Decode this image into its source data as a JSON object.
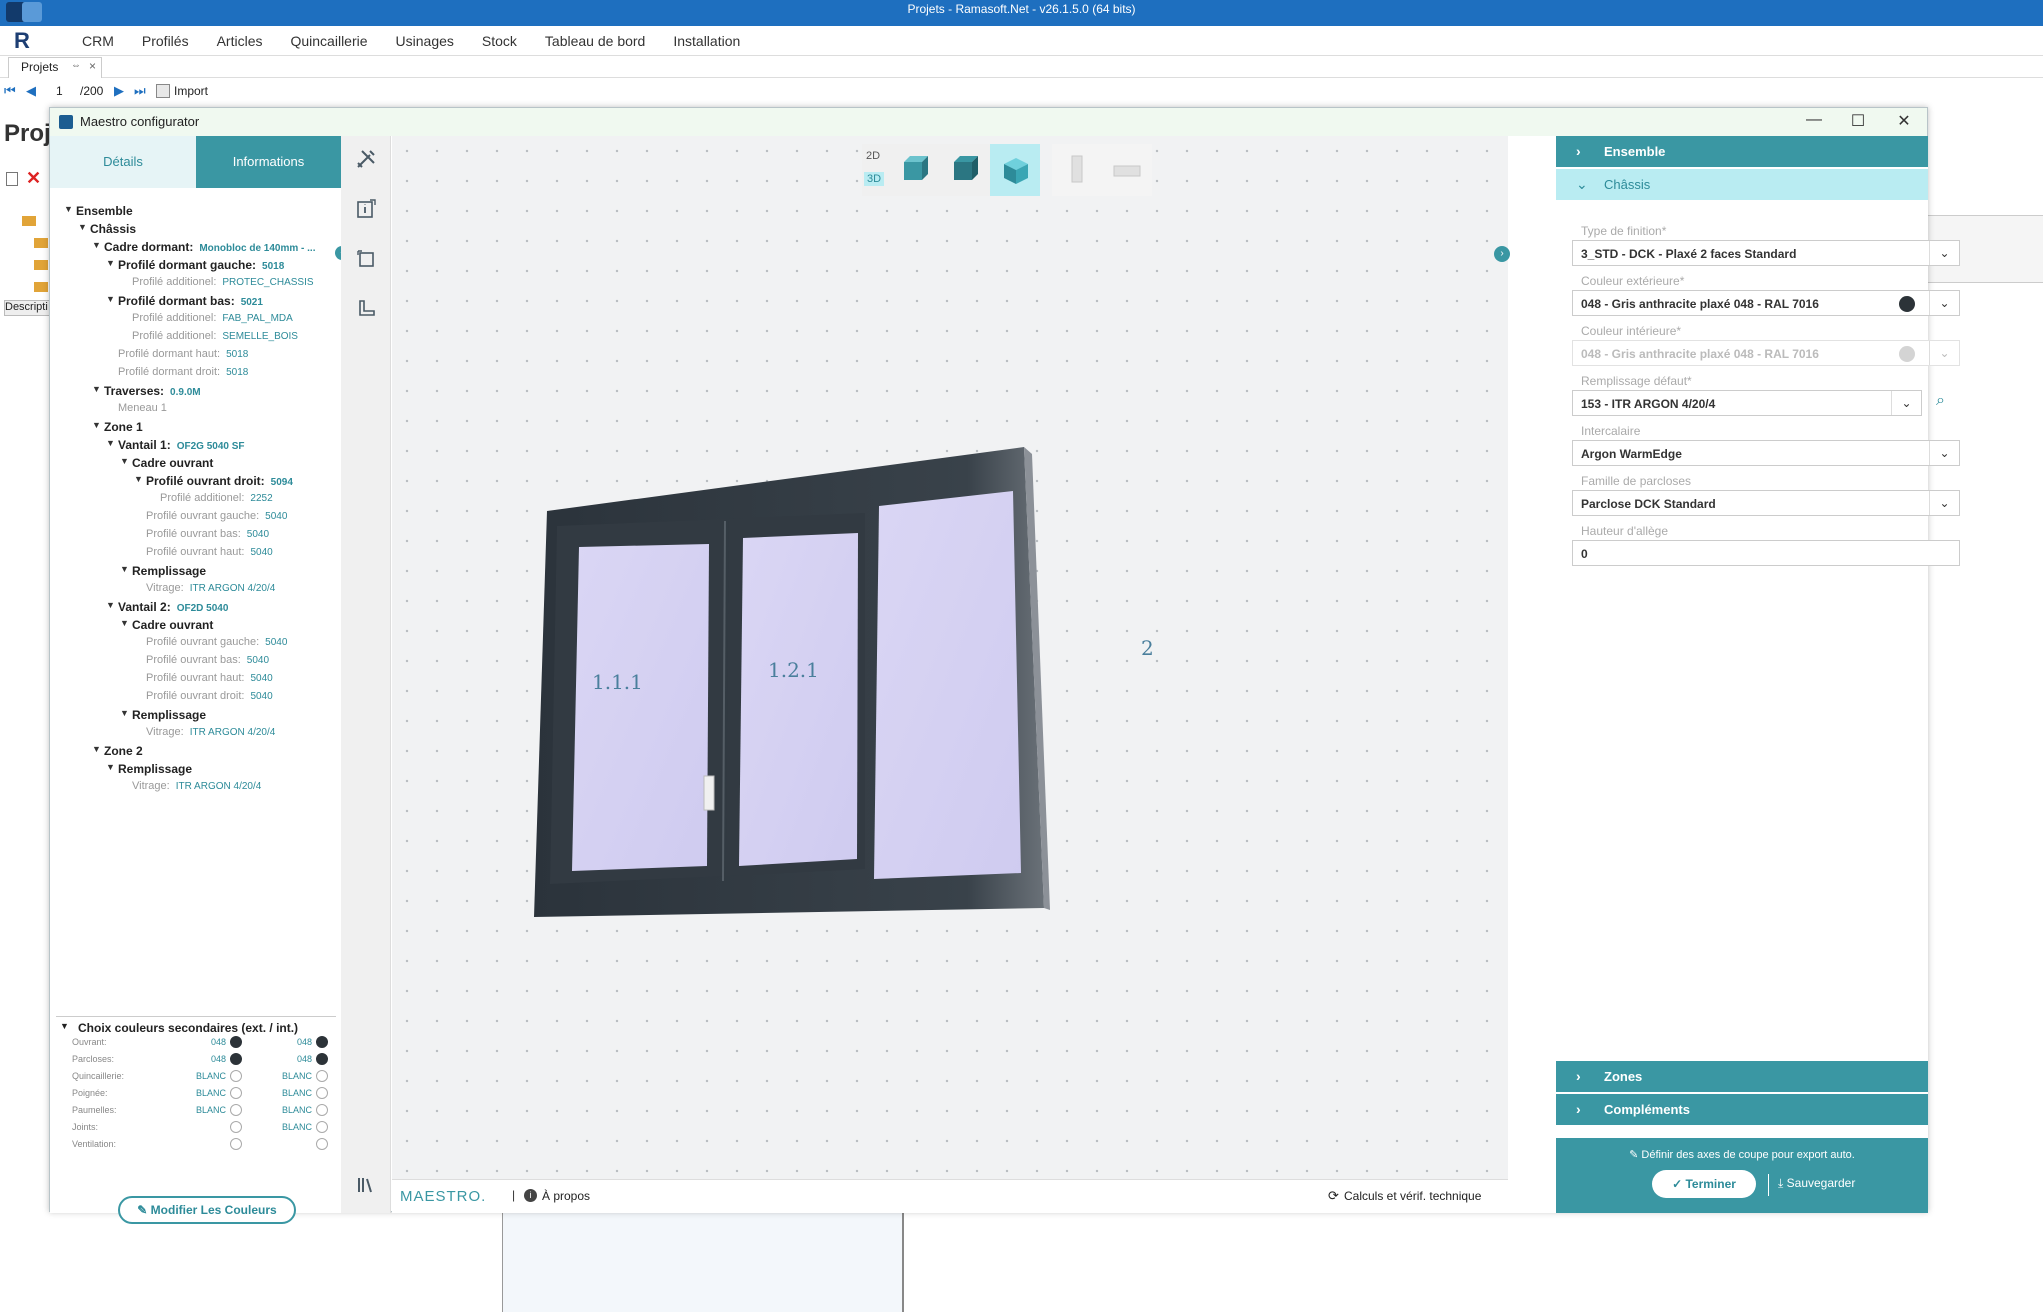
{
  "app": {
    "title": "Projets - Ramasoft.Net - v26.1.5.0 (64 bits)",
    "logo": "R",
    "menu": [
      "CRM",
      "Profilés",
      "Articles",
      "Quincaillerie",
      "Usinages",
      "Stock",
      "Tableau de bord",
      "Installation"
    ],
    "tab": {
      "label": "Projets",
      "pin": "⇔",
      "close": "×"
    },
    "nav": {
      "page": "1",
      "total": "/200",
      "import_label": "Import"
    },
    "bg": {
      "title_partial": "Proj",
      "desc": "Descripti"
    }
  },
  "window": {
    "title": "Maestro configurator",
    "controls": {
      "minimize": "—",
      "maximize": "☐",
      "close": "✕"
    }
  },
  "left": {
    "tabs": {
      "details": "Détails",
      "info": "Informations"
    },
    "tree": [
      {
        "label": "Ensemble",
        "level": 0,
        "kind": "hd",
        "caret": true
      },
      {
        "label": "Châssis",
        "level": 1,
        "kind": "hd",
        "caret": true
      },
      {
        "label": "Cadre dormant:",
        "value": "Monobloc de 140mm - ...",
        "level": 2,
        "kind": "hd",
        "caret": true
      },
      {
        "label": "Profilé dormant gauche:",
        "value": "5018",
        "level": 3,
        "kind": "hd",
        "caret": true
      },
      {
        "label": "Profilé additionel:",
        "value": "PROTEC_CHASSIS",
        "level": 4,
        "kind": "mu"
      },
      {
        "label": "Profilé dormant bas:",
        "value": "5021",
        "level": 3,
        "kind": "hd",
        "caret": true
      },
      {
        "label": "Profilé additionel:",
        "value": "FAB_PAL_MDA",
        "level": 4,
        "kind": "mu"
      },
      {
        "label": "Profilé additionel:",
        "value": "SEMELLE_BOIS",
        "level": 4,
        "kind": "mu"
      },
      {
        "label": "Profilé dormant haut:",
        "value": "5018",
        "level": 3,
        "kind": "mu"
      },
      {
        "label": "Profilé dormant droit:",
        "value": "5018",
        "level": 3,
        "kind": "mu"
      },
      {
        "label": "Traverses:",
        "value": "0.9.0M",
        "level": 2,
        "kind": "hd",
        "caret": true
      },
      {
        "label": "Meneau 1",
        "level": 3,
        "kind": "mu"
      },
      {
        "label": "Zone 1",
        "level": 2,
        "kind": "hd",
        "caret": true
      },
      {
        "label": "Vantail 1:",
        "value": "OF2G 5040 SF",
        "level": 3,
        "kind": "hd",
        "caret": true
      },
      {
        "label": "Cadre ouvrant",
        "level": 4,
        "kind": "hd",
        "caret": true
      },
      {
        "label": "Profilé ouvrant droit:",
        "value": "5094",
        "level": 5,
        "kind": "hd",
        "caret": true
      },
      {
        "label": "Profilé additionel:",
        "value": "2252",
        "level": 6,
        "kind": "mu"
      },
      {
        "label": "Profilé ouvrant gauche:",
        "value": "5040",
        "level": 5,
        "kind": "mu"
      },
      {
        "label": "Profilé ouvrant bas:",
        "value": "5040",
        "level": 5,
        "kind": "mu"
      },
      {
        "label": "Profilé ouvrant haut:",
        "value": "5040",
        "level": 5,
        "kind": "mu"
      },
      {
        "label": "Remplissage",
        "level": 4,
        "kind": "hd",
        "caret": true
      },
      {
        "label": "Vitrage:",
        "value": "ITR ARGON 4/20/4",
        "level": 5,
        "kind": "mu"
      },
      {
        "label": "Vantail 2:",
        "value": "OF2D 5040",
        "level": 3,
        "kind": "hd",
        "caret": true
      },
      {
        "label": "Cadre ouvrant",
        "level": 4,
        "kind": "hd",
        "caret": true
      },
      {
        "label": "Profilé ouvrant gauche:",
        "value": "5040",
        "level": 5,
        "kind": "mu"
      },
      {
        "label": "Profilé ouvrant bas:",
        "value": "5040",
        "level": 5,
        "kind": "mu"
      },
      {
        "label": "Profilé ouvrant haut:",
        "value": "5040",
        "level": 5,
        "kind": "mu"
      },
      {
        "label": "Profilé ouvrant droit:",
        "value": "5040",
        "level": 5,
        "kind": "mu"
      },
      {
        "label": "Remplissage",
        "level": 4,
        "kind": "hd",
        "caret": true
      },
      {
        "label": "Vitrage:",
        "value": "ITR ARGON 4/20/4",
        "level": 5,
        "kind": "mu"
      },
      {
        "label": "Zone 2",
        "level": 2,
        "kind": "hd",
        "caret": true
      },
      {
        "label": "Remplissage",
        "level": 3,
        "kind": "hd",
        "caret": true
      },
      {
        "label": "Vitrage:",
        "value": "ITR ARGON 4/20/4",
        "level": 4,
        "kind": "mu"
      }
    ],
    "colors": {
      "title": "Choix couleurs secondaires (ext. / int.)",
      "rows": [
        {
          "label": "Ouvrant:",
          "ext": "048",
          "int": "048",
          "ext_dark": true,
          "int_dark": true
        },
        {
          "label": "Parcloses:",
          "ext": "048",
          "int": "048",
          "ext_dark": true,
          "int_dark": true
        },
        {
          "label": "Quincaillerie:",
          "ext": "BLANC",
          "int": "BLANC",
          "ext_dark": false,
          "int_dark": false
        },
        {
          "label": "Poignée:",
          "ext": "BLANC",
          "int": "BLANC",
          "ext_dark": false,
          "int_dark": false
        },
        {
          "label": "Paumelles:",
          "ext": "BLANC",
          "int": "BLANC",
          "ext_dark": false,
          "int_dark": false
        },
        {
          "label": "Joints:",
          "ext": "",
          "int": "BLANC",
          "ext_dark": false,
          "int_dark": false
        },
        {
          "label": "Ventilation:",
          "ext": "",
          "int": "",
          "ext_dark": false,
          "int_dark": false
        }
      ],
      "button": "Modifier Les Couleurs"
    }
  },
  "toolbar": {
    "icons": [
      "tools-icon",
      "info-panel-icon",
      "frame-select-icon",
      "profile-section-icon",
      "library-icon"
    ]
  },
  "viewport": {
    "view": {
      "2d": "2D",
      "3d": "3D"
    },
    "zones": [
      "1.1.1",
      "1.2.1",
      "2"
    ],
    "footer": {
      "brand": "MAESTRO.",
      "about": "À propos",
      "calc": "Calculs et vérif. technique"
    }
  },
  "right": {
    "sections": {
      "ensemble": "Ensemble",
      "chassis": "Châssis",
      "zones": "Zones",
      "complements": "Compléments"
    },
    "fields": [
      {
        "label": "Type de finition*",
        "value": "3_STD - DCK - Plaxé 2 faces Standard",
        "disabled": false,
        "color": ""
      },
      {
        "label": "Couleur extérieure*",
        "value": "048 - Gris anthracite plaxé 048 - RAL 7016",
        "disabled": false,
        "color": "#2c3338"
      },
      {
        "label": "Couleur intérieure*",
        "value": "048 - Gris anthracite plaxé 048 - RAL 7016",
        "disabled": true,
        "color": "#d4d4d4"
      },
      {
        "label": "Remplissage défaut*",
        "value": "153 - ITR ARGON 4/20/4",
        "disabled": false,
        "color": "",
        "search": true
      },
      {
        "label": "Intercalaire",
        "value": "Argon WarmEdge",
        "disabled": false,
        "color": ""
      },
      {
        "label": "Famille de parcloses",
        "value": "Parclose DCK Standard",
        "disabled": false,
        "color": ""
      },
      {
        "label": "Hauteur d'allège",
        "value": "0",
        "disabled": false,
        "color": "",
        "input": true
      }
    ],
    "footer": {
      "axes": "Définir des axes de coupe pour export auto.",
      "terminer": "Terminer",
      "sauvegarder": "Sauvegarder"
    }
  }
}
